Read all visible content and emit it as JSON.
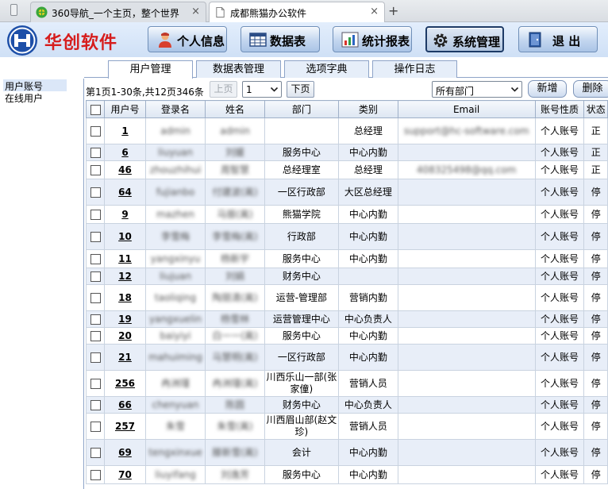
{
  "browser": {
    "tabs": [
      {
        "title": "360导航_一个主页，整个世界",
        "close": "×"
      },
      {
        "title": "成都熊猫办公软件",
        "close": "×"
      }
    ],
    "new_tab": "+"
  },
  "header": {
    "brand": "华创软件",
    "buttons": [
      {
        "label": "个人信息",
        "icon": "person-icon"
      },
      {
        "label": "数据表",
        "icon": "table-icon"
      },
      {
        "label": "统计报表",
        "icon": "chart-icon"
      },
      {
        "label": "系统管理",
        "icon": "gear-icon"
      },
      {
        "label": "退 出",
        "icon": "exit-icon"
      }
    ]
  },
  "sidebar": {
    "items": [
      "用户账号",
      "在线用户"
    ]
  },
  "subtabs": [
    "用户管理",
    "数据表管理",
    "选项字典",
    "操作日志"
  ],
  "toolbar": {
    "page_info": "第1页1-30条,共12页346条",
    "prev": "上页",
    "page_select": "1",
    "next": "下页",
    "dept_select": "所有部门",
    "add": "新增",
    "delete": "删除"
  },
  "table": {
    "columns": [
      "用户号",
      "登录名",
      "姓名",
      "部门",
      "类别",
      "Email",
      "账号性质",
      "状态"
    ],
    "rows": [
      {
        "id": "1",
        "login": "admin",
        "name": "admin",
        "dept": "",
        "category": "总经理",
        "email": "support@hc-software.com",
        "account_type": "个人账号",
        "status": "正"
      },
      {
        "id": "6",
        "login": "liuyuan",
        "name": "刘媛",
        "dept": "服务中心",
        "category": "中心内勤",
        "email": "",
        "account_type": "个人账号",
        "status": "正"
      },
      {
        "id": "46",
        "login": "zhouzhihui",
        "name": "周智慧",
        "dept": "总经理室",
        "category": "总经理",
        "email": "408325498@qq.com",
        "account_type": "个人账号",
        "status": "正"
      },
      {
        "id": "64",
        "login": "fujianbo",
        "name": "付建波(离)",
        "dept": "一区行政部",
        "category": "大区总经理",
        "email": "",
        "account_type": "个人账号",
        "status": "停"
      },
      {
        "id": "9",
        "login": "mazhen",
        "name": "马振(离)",
        "dept": "熊猫学院",
        "category": "中心内勤",
        "email": "",
        "account_type": "个人账号",
        "status": "停"
      },
      {
        "id": "10",
        "login": "李雪梅",
        "name": "李雪梅(离)",
        "dept": "行政部",
        "category": "中心内勤",
        "email": "",
        "account_type": "个人账号",
        "status": "停"
      },
      {
        "id": "11",
        "login": "yangxinyu",
        "name": "杨新宇",
        "dept": "服务中心",
        "category": "中心内勤",
        "email": "",
        "account_type": "个人账号",
        "status": "停"
      },
      {
        "id": "12",
        "login": "liujuan",
        "name": "刘娟",
        "dept": "财务中心",
        "category": "",
        "email": "",
        "account_type": "个人账号",
        "status": "停"
      },
      {
        "id": "18",
        "login": "taoliqing",
        "name": "陶丽清(离)",
        "dept": "运营-管理部",
        "category": "营销内勤",
        "email": "",
        "account_type": "个人账号",
        "status": "停"
      },
      {
        "id": "19",
        "login": "yangxuelin",
        "name": "杨雪林",
        "dept": "运营管理中心",
        "category": "中心负责人",
        "email": "",
        "account_type": "个人账号",
        "status": "停"
      },
      {
        "id": "20",
        "login": "baiyiyi",
        "name": "白一一(离)",
        "dept": "服务中心",
        "category": "中心内勤",
        "email": "",
        "account_type": "个人账号",
        "status": "停"
      },
      {
        "id": "21",
        "login": "mahuiming",
        "name": "马慧明(离)",
        "dept": "一区行政部",
        "category": "中心内勤",
        "email": "",
        "account_type": "个人账号",
        "status": "停"
      },
      {
        "id": "256",
        "login": "冉洲瑾",
        "name": "冉洲瑾(离)",
        "dept": "川西乐山一部(张家僮)",
        "category": "营销人员",
        "email": "",
        "account_type": "个人账号",
        "status": "停"
      },
      {
        "id": "66",
        "login": "chenyuan",
        "name": "陈圆",
        "dept": "财务中心",
        "category": "中心负责人",
        "email": "",
        "account_type": "个人账号",
        "status": "停"
      },
      {
        "id": "257",
        "login": "朱雪",
        "name": "朱雪(离)",
        "dept": "川西眉山部(赵文珍)",
        "category": "营销人员",
        "email": "",
        "account_type": "个人账号",
        "status": "停"
      },
      {
        "id": "69",
        "login": "tengxinxue",
        "name": "滕新雪(离)",
        "dept": "会计",
        "category": "中心内勤",
        "email": "",
        "account_type": "个人账号",
        "status": "停"
      },
      {
        "id": "70",
        "login": "liuyifang",
        "name": "刘逸芳",
        "dept": "服务中心",
        "category": "中心内勤",
        "email": "",
        "account_type": "个人账号",
        "status": "停"
      }
    ]
  }
}
